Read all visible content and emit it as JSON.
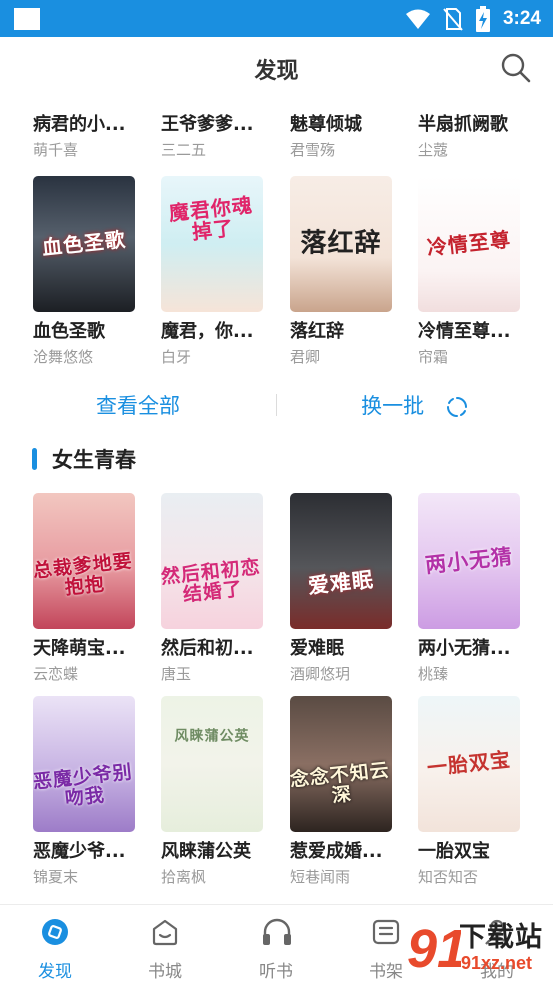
{
  "status_bar": {
    "time": "3:24"
  },
  "header": {
    "title": "发现"
  },
  "top_partial_row": [
    {
      "title": "病君的小...",
      "author": "萌千喜"
    },
    {
      "title": "王爷爹爹...",
      "author": "三二五"
    },
    {
      "title": "魅尊倾城",
      "author": "君雪殇"
    },
    {
      "title": "半扇抓阙歌",
      "author": "尘蔻"
    }
  ],
  "row1": [
    {
      "title": "血色圣歌",
      "author": "沧舞悠悠",
      "cover_text": "血色圣歌"
    },
    {
      "title": "魔君，你...",
      "author": "白牙",
      "cover_text": "魔君你魂掉了"
    },
    {
      "title": "落红辞",
      "author": "君卿",
      "cover_text": "落红辞"
    },
    {
      "title": "冷情至尊...",
      "author": "帘霜",
      "cover_text": "冷情至尊"
    }
  ],
  "actions": {
    "view_all": "查看全部",
    "refresh": "换一批"
  },
  "section": {
    "title": "女生青春"
  },
  "row2": [
    {
      "title": "天降萌宝...",
      "author": "云恋蝶",
      "cover_text": "总裁爹地要抱抱"
    },
    {
      "title": "然后和初...",
      "author": "唐玉",
      "cover_text": "然后和初恋结婚了"
    },
    {
      "title": "爱难眠",
      "author": "酒卿悠玥",
      "cover_text": "爱难眠"
    },
    {
      "title": "两小无猜...",
      "author": "桃臻",
      "cover_text": "两小无猜"
    }
  ],
  "row3": [
    {
      "title": "恶魔少爷...",
      "author": "锦夏末",
      "cover_text": "恶魔少爷别吻我"
    },
    {
      "title": "风睐蒲公英",
      "author": "拾离枫",
      "cover_text": "风睐蒲公英"
    },
    {
      "title": "惹爱成婚...",
      "author": "短巷闻雨",
      "cover_text": "念念不知云深"
    },
    {
      "title": "一胎双宝",
      "author": "知否知否",
      "cover_text": "一胎双宝"
    }
  ],
  "tabbar": [
    {
      "label": "发现",
      "active": true
    },
    {
      "label": "书城",
      "active": false
    },
    {
      "label": "听书",
      "active": false
    },
    {
      "label": "书架",
      "active": false
    },
    {
      "label": "我的",
      "active": false
    }
  ],
  "watermark": {
    "big": "下载站",
    "small": "91xz.net",
    "badge": "91"
  },
  "colors": {
    "accent": "#1a8fe0",
    "status_bar": "#1a8fe0",
    "muted": "#9a9a9a"
  }
}
